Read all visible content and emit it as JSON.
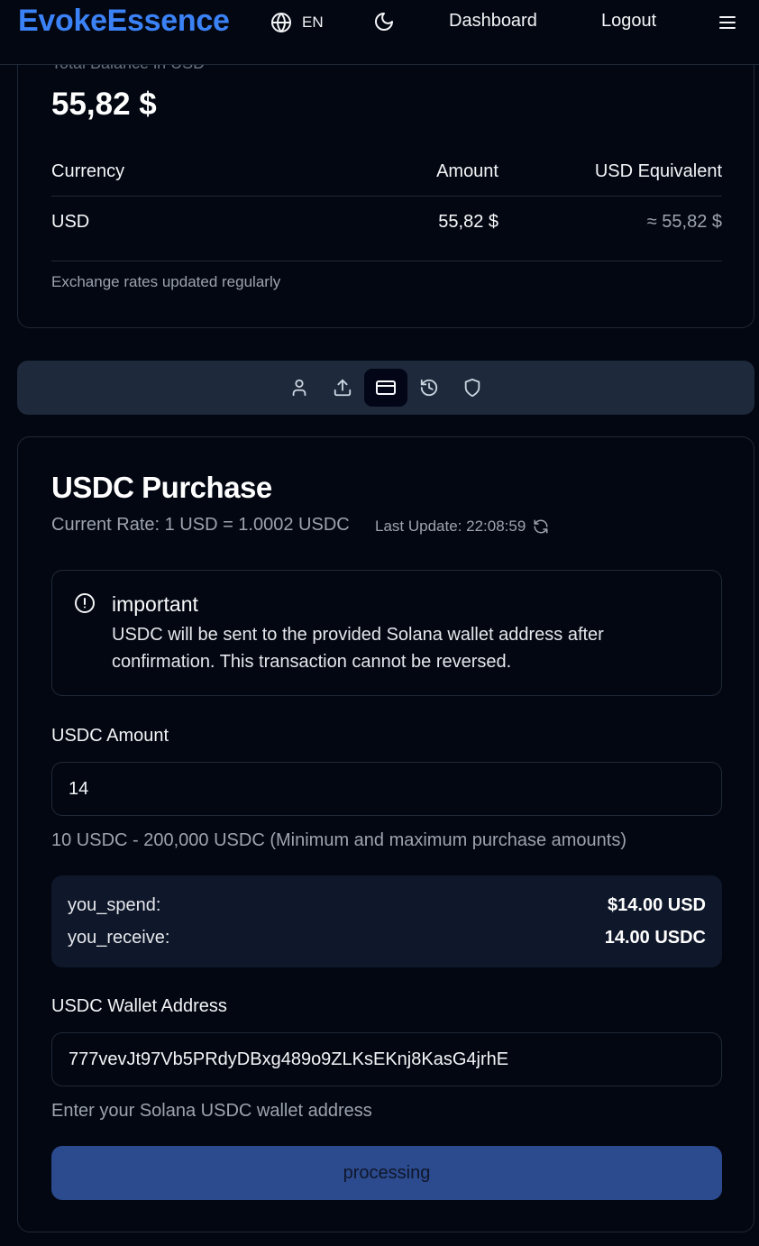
{
  "header": {
    "brand": "EvokeEssence",
    "language": "EN",
    "nav_dashboard": "Dashboard",
    "nav_logout": "Logout",
    "icons": {
      "language": "globe-icon",
      "theme": "moon-icon",
      "menu": "hamburger-menu-icon"
    }
  },
  "balance": {
    "label": "Total Balance in USD",
    "total": "55,82 $",
    "columns": [
      "Currency",
      "Amount",
      "USD Equivalent"
    ],
    "rows": [
      {
        "currency": "USD",
        "amount": "55,82 $",
        "usd_equivalent": "≈ 55,82 $"
      }
    ],
    "note": "Exchange rates updated regularly"
  },
  "tabs": [
    {
      "icon": "user-icon",
      "active": false
    },
    {
      "icon": "upload-icon",
      "active": false
    },
    {
      "icon": "credit-card-icon",
      "active": true
    },
    {
      "icon": "history-icon",
      "active": false
    },
    {
      "icon": "shield-icon",
      "active": false
    }
  ],
  "purchase": {
    "title": "USDC Purchase",
    "rate": "Current Rate: 1 USD = 1.0002 USDC",
    "last_update": "Last Update: 22:08:59",
    "alert": {
      "title": "important",
      "text": "USDC will be sent to the provided Solana wallet address after confirmation. This transaction cannot be reversed."
    },
    "amount_label": "USDC Amount",
    "amount_value": "14",
    "amount_hint": "10 USDC - 200,000 USDC (Minimum and maximum purchase amounts)",
    "summary": {
      "spend_label": "you_spend:",
      "spend_value": "$14.00 USD",
      "receive_label": "you_receive:",
      "receive_value": "14.00 USDC"
    },
    "wallet_label": "USDC Wallet Address",
    "wallet_value": "777vevJt97Vb5PRdyDBxg489o9ZLKsEKnj8KasG4jrhE",
    "wallet_hint": "Enter your Solana USDC wallet address",
    "submit_label": "processing"
  },
  "colors": {
    "background": "#030712",
    "brand": "#3b82f6",
    "tabbar": "#1e293b",
    "button": "#2c4a8e"
  }
}
